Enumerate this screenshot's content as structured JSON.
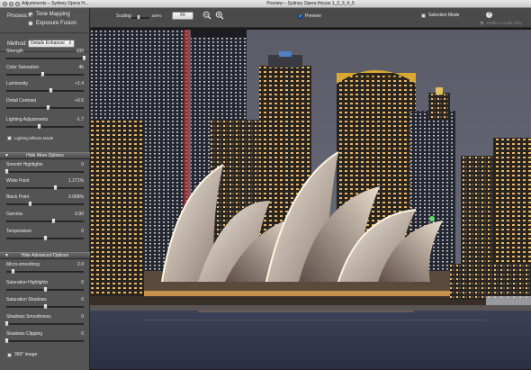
{
  "left_window": {
    "title": "Adjustments – Sydney Opera H..."
  },
  "process": {
    "label": "Process:",
    "options": [
      "Tone Mapping",
      "Exposure Fusion"
    ],
    "selected": "Tone Mapping"
  },
  "method": {
    "label": "Method:",
    "value": "Details Enhancer"
  },
  "sliders_main": [
    {
      "label": "Strength",
      "value": "100",
      "fraction": 1.0
    },
    {
      "label": "Color Saturation",
      "value": "46",
      "fraction": 0.46
    },
    {
      "label": "Luminosity",
      "value": "+1.4",
      "fraction": 0.57
    },
    {
      "label": "Detail Contrast",
      "value": "+0.6",
      "fraction": 0.53
    },
    {
      "label": "Lighting Adjustments",
      "value": "-1.7",
      "fraction": 0.42
    }
  ],
  "lighting_effects": {
    "label": "Lighting Effects Mode"
  },
  "section_more": {
    "label": "Hide More Options"
  },
  "sliders_more": [
    {
      "label": "Smooth Highlights",
      "value": "0",
      "fraction": 0.0
    },
    {
      "label": "White Point",
      "value": "1.271%",
      "fraction": 0.63
    },
    {
      "label": "Black Point",
      "value": "3.068%",
      "fraction": 0.3
    },
    {
      "label": "Gamma",
      "value": "0.90",
      "fraction": 0.6
    },
    {
      "label": "Temperature",
      "value": "0",
      "fraction": 0.5
    }
  ],
  "section_advanced": {
    "label": "Hide Advanced Options"
  },
  "sliders_advanced": [
    {
      "label": "Micro-smoothing",
      "value": "2.0",
      "fraction": 0.08
    },
    {
      "label": "Saturation Highlights",
      "value": "0",
      "fraction": 0.5
    },
    {
      "label": "Saturation Shadows",
      "value": "0",
      "fraction": 0.5
    },
    {
      "label": "Shadows Smoothness",
      "value": "0",
      "fraction": 0.0
    },
    {
      "label": "Shadows Clipping",
      "value": "0",
      "fraction": 0.0
    }
  ],
  "image_360": {
    "label": "360° image"
  },
  "main_window": {
    "title": "Preview – Sydney Opera House 1_2_3_4_5"
  },
  "toolbar": {
    "scaling_label": "Scaling:",
    "scaling_value": "100%",
    "fit_label": "Fit",
    "preview_label": "Preview",
    "preview_checked": true,
    "selection_mode_label": "Selection Mode",
    "help_label": "?",
    "reflect_label": "Reflect Locals Only"
  },
  "photo": {
    "sign_text": "SHANGRI-LA HOTEL"
  },
  "icons": {
    "zoom_in": "zoom-in-icon",
    "zoom_out": "zoom-out-icon"
  }
}
